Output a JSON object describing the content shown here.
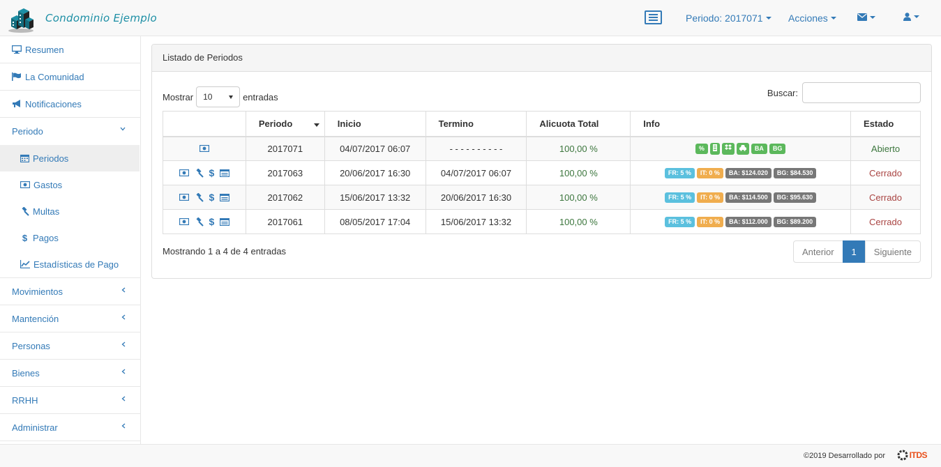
{
  "navbar": {
    "brand": "Condominio Ejemplo",
    "periodo": "Periodo: 2017071",
    "acciones": "Acciones"
  },
  "sidebar": {
    "items": [
      {
        "label": "Resumen"
      },
      {
        "label": "La Comunidad"
      },
      {
        "label": "Notificaciones"
      },
      {
        "label": "Periodo"
      },
      {
        "label": "Movimientos"
      },
      {
        "label": "Mantención"
      },
      {
        "label": "Personas"
      },
      {
        "label": "Bienes"
      },
      {
        "label": "RRHH"
      },
      {
        "label": "Administrar"
      }
    ],
    "sub": [
      {
        "label": "Periodos"
      },
      {
        "label": "Gastos"
      },
      {
        "label": "Multas"
      },
      {
        "label": "Pagos"
      },
      {
        "label": "Estadísticas de Pago"
      }
    ]
  },
  "panel": {
    "title": "Listado de Periodos",
    "show_label": "Mostrar",
    "show_value": "10",
    "entries_label": "entradas",
    "search_label": "Buscar:",
    "search_value": ""
  },
  "table": {
    "headers": [
      "",
      "Periodo",
      "Inicio",
      "Termino",
      "Alicuota Total",
      "Info",
      "Estado"
    ],
    "rows": [
      {
        "periodo": "2017071",
        "inicio": "04/07/2017 06:07",
        "termino": "- - - - - - - - - -",
        "alicuota": "100,00 %",
        "estado": "Abierto"
      },
      {
        "periodo": "2017063",
        "inicio": "20/06/2017 16:30",
        "termino": "04/07/2017 06:07",
        "alicuota": "100,00 %",
        "estado": "Cerrado",
        "fr": "FR: 5 %",
        "it": "IT: 0 %",
        "ba": "BA: $124.020",
        "bg": "BG: $84.530"
      },
      {
        "periodo": "2017062",
        "inicio": "15/06/2017 13:32",
        "termino": "20/06/2017 16:30",
        "alicuota": "100,00 %",
        "estado": "Cerrado",
        "fr": "FR: 5 %",
        "it": "IT: 0 %",
        "ba": "BA: $114.500",
        "bg": "BG: $95.630"
      },
      {
        "periodo": "2017061",
        "inicio": "08/05/2017 17:04",
        "termino": "15/06/2017 13:32",
        "alicuota": "100,00 %",
        "estado": "Cerrado",
        "fr": "FR: 5 %",
        "it": "IT: 0 %",
        "ba": "BA: $112.000",
        "bg": "BG: $89.200"
      }
    ],
    "open_badges": [
      "%",
      "BA",
      "BG"
    ]
  },
  "footer_info": "Mostrando 1 a 4 de 4 entradas",
  "pagination": {
    "prev": "Anterior",
    "page": "1",
    "next": "Siguiente"
  },
  "footer": {
    "text": "©2019 Desarrollado por",
    "logo": "ITDS"
  },
  "colors": {
    "link": "#337ab7",
    "brand": "#1d8fa5",
    "success": "#5cb85c",
    "info": "#5bc0de",
    "warning": "#f0ad4e",
    "default": "#777777"
  }
}
